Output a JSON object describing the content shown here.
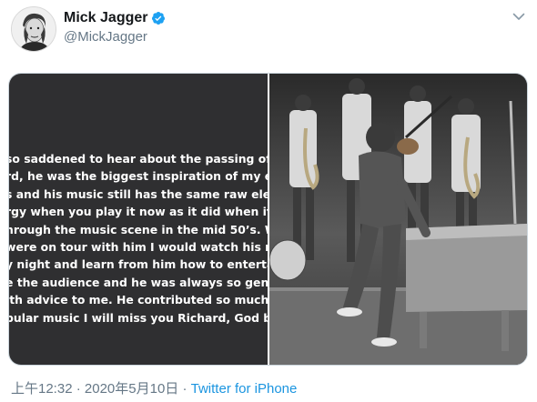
{
  "author": {
    "name": "Mick Jagger",
    "handle": "@MickJagger",
    "verified": true
  },
  "media": {
    "text_lines": [
      "so saddened to hear about the passing of L",
      "rd, he was the biggest inspiration of my e",
      "s and his music still has the same raw ele",
      "rgy when you play it now as it did when it f",
      "hrough the music scene in the mid 50’s. W",
      "were on tour with him I would watch his mo",
      "y night and learn from him how to entertai",
      "e the audience and he was always so gene",
      "ith advice to me. He contributed so much t",
      "pular music I will miss you Richard, God ble"
    ],
    "photo_icon": "photo-image"
  },
  "meta": {
    "time": "上午12:32",
    "separator": "·",
    "date": "2020年5月10日",
    "source": "Twitter for iPhone"
  },
  "colors": {
    "link": "#1b95e0",
    "secondary": "#657786",
    "verified": "#1da1f2",
    "note_bg": "#2f2f31"
  }
}
